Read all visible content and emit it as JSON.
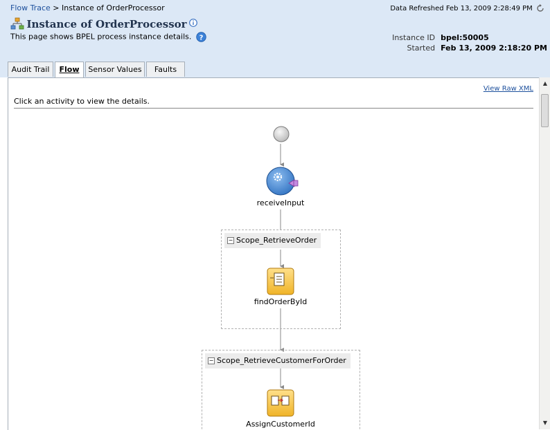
{
  "breadcrumb": {
    "link": "Flow Trace",
    "separator": ">",
    "current": "Instance of OrderProcessor"
  },
  "refreshed": "Data Refreshed Feb 13, 2009 2:28:49 PM",
  "title": "Instance of OrderProcessor",
  "subtitle": "This page shows BPEL process instance details.",
  "meta": {
    "instance_id_label": "Instance ID",
    "instance_id_value": "bpel:50005",
    "started_label": "Started",
    "started_value": "Feb 13, 2009 2:18:20 PM"
  },
  "tabs": [
    {
      "label": "Audit Trail",
      "active": false
    },
    {
      "label": "Flow",
      "active": true
    },
    {
      "label": "Sensor Values",
      "active": false
    },
    {
      "label": "Faults",
      "active": false
    }
  ],
  "view_raw_xml": "View Raw XML",
  "instructions": "Click an activity to view the details.",
  "flow": {
    "start_icon": "start-circle-icon",
    "receive_label": "receiveInput",
    "scope1_label": "Scope_RetrieveOrder",
    "activity1_label": "findOrderById",
    "scope2_label": "Scope_RetrieveCustomerForOrder",
    "activity2_label": "AssignCustomerId"
  },
  "colors": {
    "header_bg": "#dce8f6",
    "link": "#1c4f9c",
    "activity_yellow": "#f7c948",
    "receive_blue": "#4c8fd6"
  }
}
